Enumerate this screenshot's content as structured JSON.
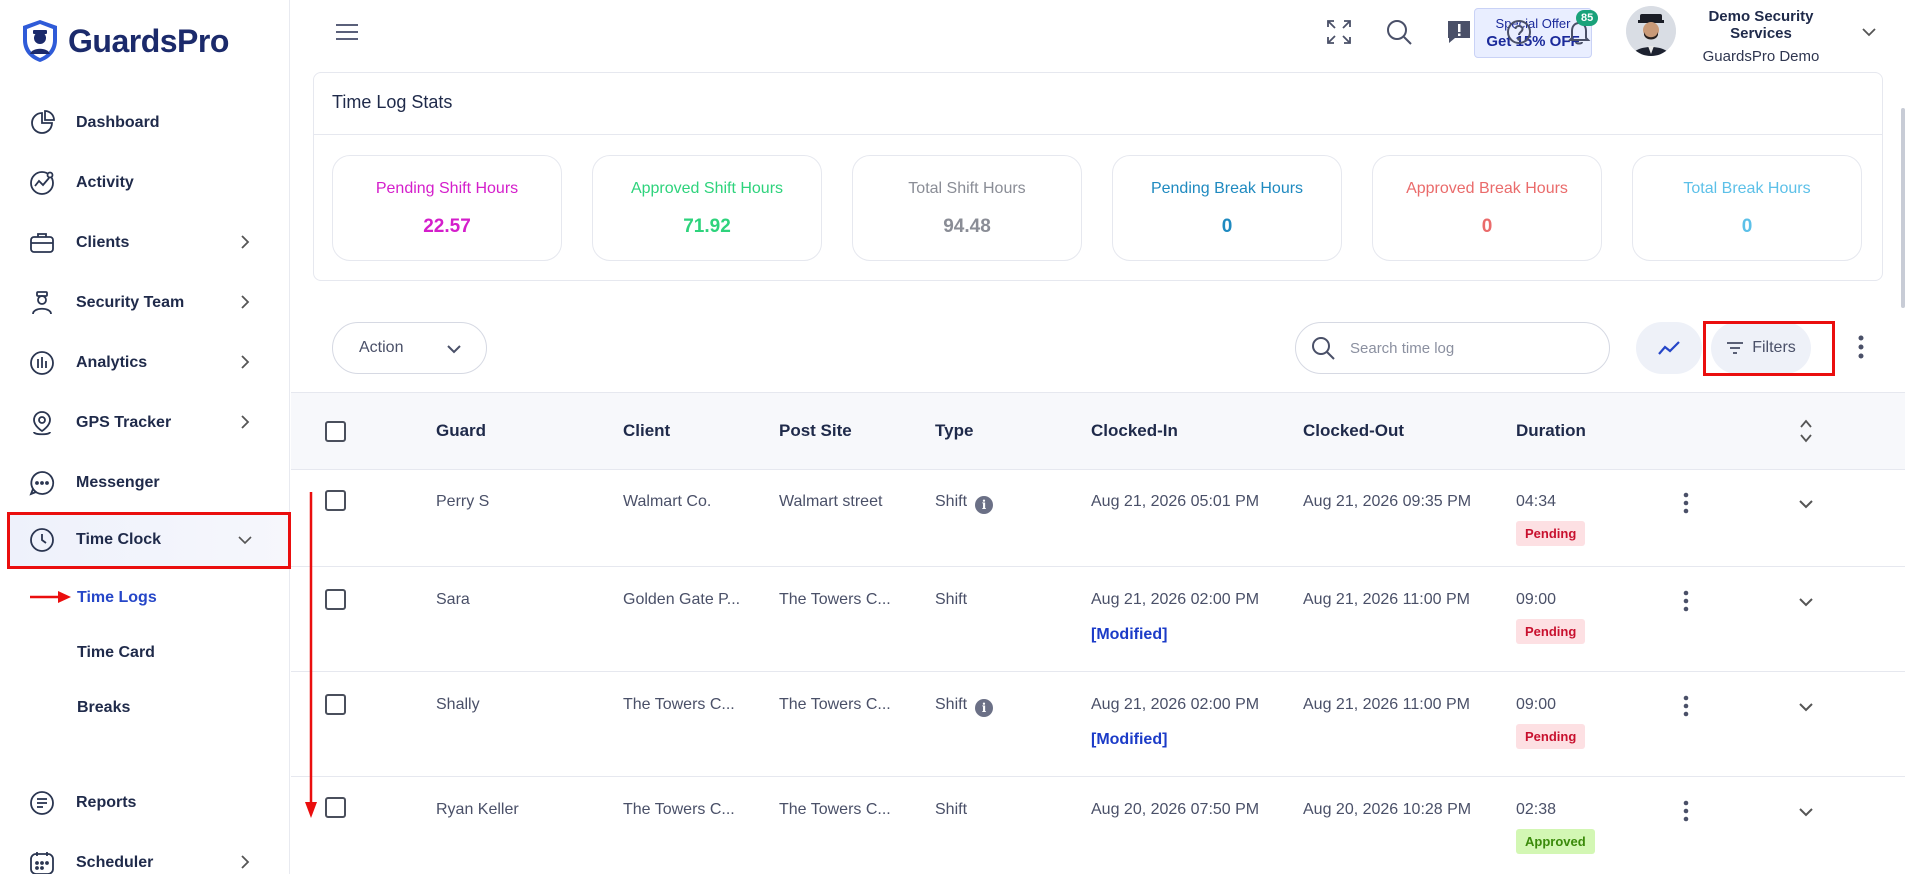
{
  "brand": {
    "name": "GuardsPro"
  },
  "sidebar": {
    "items": [
      {
        "label": "Dashboard",
        "icon": "pie-chart-icon"
      },
      {
        "label": "Activity",
        "icon": "activity-icon"
      },
      {
        "label": "Clients",
        "icon": "briefcase-icon"
      },
      {
        "label": "Security Team",
        "icon": "guard-icon"
      },
      {
        "label": "Analytics",
        "icon": "bar-chart-icon"
      },
      {
        "label": "GPS Tracker",
        "icon": "location-pin-icon"
      },
      {
        "label": "Messenger",
        "icon": "chat-bubble-icon"
      },
      {
        "label": "Time Clock",
        "icon": "clock-icon"
      },
      {
        "label": "Reports",
        "icon": "document-icon"
      },
      {
        "label": "Scheduler",
        "icon": "calendar-icon"
      }
    ],
    "sub_items": [
      "Time Logs",
      "Time Card",
      "Breaks"
    ]
  },
  "header": {
    "offer_line1": "Special Offer",
    "offer_line2": "Get 15% OFF",
    "notification_count": "85",
    "company_name": "Demo Security Services",
    "account_name": "GuardsPro Demo"
  },
  "stats": {
    "title": "Time Log Stats",
    "cards": [
      {
        "label": "Pending Shift Hours",
        "value": "22.57",
        "color": "#d41ecb"
      },
      {
        "label": "Approved Shift Hours",
        "value": "71.92",
        "color": "#2ed37c"
      },
      {
        "label": "Total Shift Hours",
        "value": "94.48",
        "color": "#8a8d96"
      },
      {
        "label": "Pending Break Hours",
        "value": "0",
        "color": "#1f8ac0"
      },
      {
        "label": "Approved Break Hours",
        "value": "0",
        "color": "#ea6b6b"
      },
      {
        "label": "Total Break Hours",
        "value": "0",
        "color": "#5cc0e8"
      }
    ]
  },
  "toolbar": {
    "action_label": "Action",
    "search_placeholder": "Search time log",
    "filters_label": "Filters"
  },
  "table": {
    "columns": [
      "Guard",
      "Client",
      "Post Site",
      "Type",
      "Clocked-In",
      "Clocked-Out",
      "Duration"
    ],
    "rows": [
      {
        "guard": "Perry S",
        "client": "Walmart Co.",
        "post_site": "Walmart street",
        "type": "Shift",
        "info": true,
        "clocked_in": "Aug 21, 2026 05:01 PM",
        "modified": "",
        "clocked_out": "Aug 21, 2026 09:35 PM",
        "duration": "04:34",
        "status": "Pending"
      },
      {
        "guard": "Sara",
        "client": "Golden Gate P...",
        "post_site": "The Towers C...",
        "type": "Shift",
        "info": false,
        "clocked_in": "Aug 21, 2026 02:00 PM",
        "modified": "[Modified]",
        "clocked_out": "Aug 21, 2026 11:00 PM",
        "duration": "09:00",
        "status": "Pending"
      },
      {
        "guard": "Shally",
        "client": "The Towers C...",
        "post_site": "The Towers C...",
        "type": "Shift",
        "info": true,
        "clocked_in": "Aug 21, 2026 02:00 PM",
        "modified": "[Modified]",
        "clocked_out": "Aug 21, 2026 11:00 PM",
        "duration": "09:00",
        "status": "Pending"
      },
      {
        "guard": "Ryan Keller",
        "client": "The Towers C...",
        "post_site": "The Towers C...",
        "type": "Shift",
        "info": false,
        "clocked_in": "Aug 20, 2026 07:50 PM",
        "modified": "",
        "clocked_out": "Aug 20, 2026 10:28 PM",
        "duration": "02:38",
        "status": "Approved"
      }
    ]
  },
  "colors": {
    "accent": "#2546c8",
    "highlight": "#ea0e0e"
  }
}
